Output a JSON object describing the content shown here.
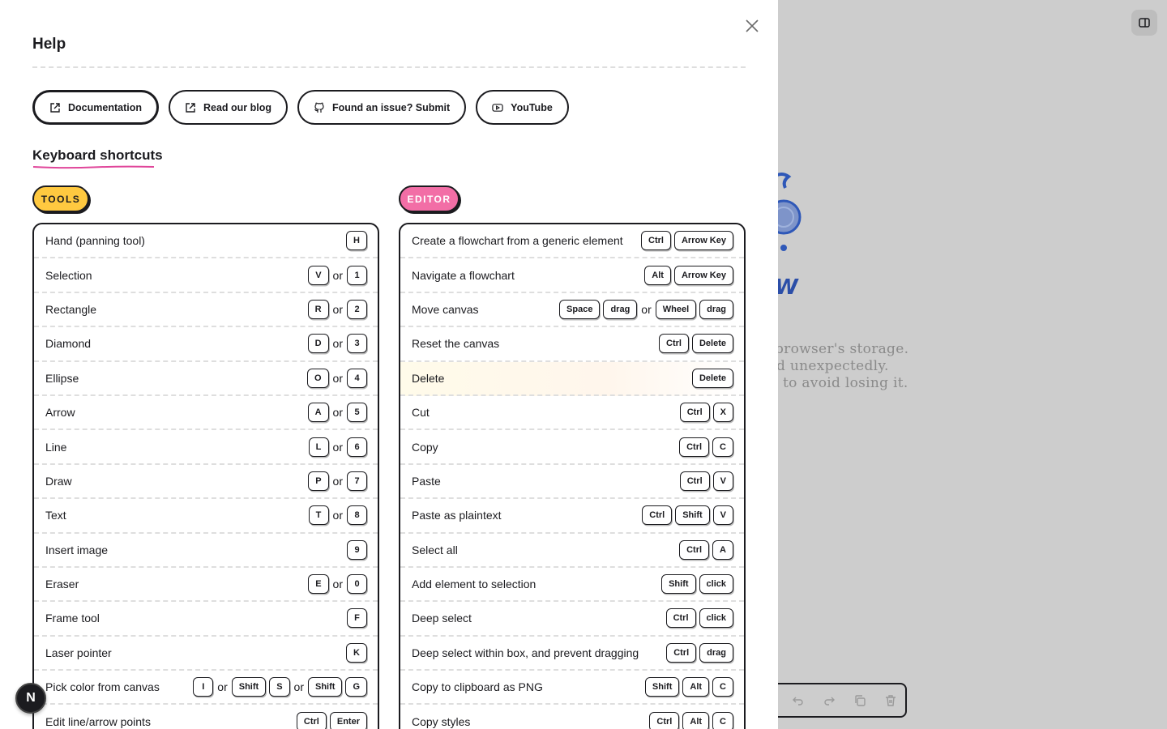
{
  "dialog": {
    "title": "Help",
    "links": [
      {
        "label": "Documentation",
        "icon": "external-link-icon"
      },
      {
        "label": "Read our blog",
        "icon": "external-link-icon"
      },
      {
        "label": "Found an issue? Submit",
        "icon": "github-icon"
      },
      {
        "label": "YouTube",
        "icon": "youtube-icon"
      }
    ],
    "shortcuts_heading": "Keyboard shortcuts",
    "tools_label": "TOOLS",
    "editor_label": "EDITOR",
    "or_text": "or"
  },
  "tools": [
    {
      "label": "Hand (panning tool)",
      "keys": [
        [
          "H"
        ]
      ]
    },
    {
      "label": "Selection",
      "keys": [
        [
          "V"
        ],
        [
          "1"
        ]
      ]
    },
    {
      "label": "Rectangle",
      "keys": [
        [
          "R"
        ],
        [
          "2"
        ]
      ]
    },
    {
      "label": "Diamond",
      "keys": [
        [
          "D"
        ],
        [
          "3"
        ]
      ]
    },
    {
      "label": "Ellipse",
      "keys": [
        [
          "O"
        ],
        [
          "4"
        ]
      ]
    },
    {
      "label": "Arrow",
      "keys": [
        [
          "A"
        ],
        [
          "5"
        ]
      ]
    },
    {
      "label": "Line",
      "keys": [
        [
          "L"
        ],
        [
          "6"
        ]
      ]
    },
    {
      "label": "Draw",
      "keys": [
        [
          "P"
        ],
        [
          "7"
        ]
      ]
    },
    {
      "label": "Text",
      "keys": [
        [
          "T"
        ],
        [
          "8"
        ]
      ]
    },
    {
      "label": "Insert image",
      "keys": [
        [
          "9"
        ]
      ]
    },
    {
      "label": "Eraser",
      "keys": [
        [
          "E"
        ],
        [
          "0"
        ]
      ]
    },
    {
      "label": "Frame tool",
      "keys": [
        [
          "F"
        ]
      ]
    },
    {
      "label": "Laser pointer",
      "keys": [
        [
          "K"
        ]
      ]
    },
    {
      "label": "Pick color from canvas",
      "keys": [
        [
          "I"
        ],
        [
          "Shift",
          "S"
        ],
        [
          "Shift",
          "G"
        ]
      ]
    },
    {
      "label": "Edit line/arrow points",
      "keys": [
        [
          "Ctrl",
          "Enter"
        ]
      ]
    }
  ],
  "editor": [
    {
      "label": "Create a flowchart from a generic element",
      "keys": [
        [
          "Ctrl",
          "Arrow Key"
        ]
      ]
    },
    {
      "label": "Navigate a flowchart",
      "keys": [
        [
          "Alt",
          "Arrow Key"
        ]
      ]
    },
    {
      "label": "Move canvas",
      "keys": [
        [
          "Space",
          "drag"
        ],
        [
          "Wheel",
          "drag"
        ]
      ]
    },
    {
      "label": "Reset the canvas",
      "keys": [
        [
          "Ctrl",
          "Delete"
        ]
      ]
    },
    {
      "label": "Delete",
      "keys": [
        [
          "Delete"
        ]
      ],
      "highlight": true
    },
    {
      "label": "Cut",
      "keys": [
        [
          "Ctrl",
          "X"
        ]
      ]
    },
    {
      "label": "Copy",
      "keys": [
        [
          "Ctrl",
          "C"
        ]
      ]
    },
    {
      "label": "Paste",
      "keys": [
        [
          "Ctrl",
          "V"
        ]
      ]
    },
    {
      "label": "Paste as plaintext",
      "keys": [
        [
          "Ctrl",
          "Shift",
          "V"
        ]
      ]
    },
    {
      "label": "Select all",
      "keys": [
        [
          "Ctrl",
          "A"
        ]
      ]
    },
    {
      "label": "Add element to selection",
      "keys": [
        [
          "Shift",
          "click"
        ]
      ]
    },
    {
      "label": "Deep select",
      "keys": [
        [
          "Ctrl",
          "click"
        ]
      ]
    },
    {
      "label": "Deep select within box, and prevent dragging",
      "keys": [
        [
          "Ctrl",
          "drag"
        ]
      ]
    },
    {
      "label": "Copy to clipboard as PNG",
      "keys": [
        [
          "Shift",
          "Alt",
          "C"
        ]
      ]
    },
    {
      "label": "Copy styles",
      "keys": [
        [
          "Ctrl",
          "Alt",
          "C"
        ]
      ]
    }
  ],
  "background": {
    "logo_letter": "W",
    "welcome_lines": [
      "browser's storage.",
      "d unexpectedly.",
      "to avoid losing it."
    ]
  },
  "avatar": {
    "initial": "N"
  },
  "colors": {
    "tools_pill": "#ffc940",
    "editor_pill": "#f26ea6",
    "underline": "#e0469a",
    "ink": "#1b1b1f"
  }
}
